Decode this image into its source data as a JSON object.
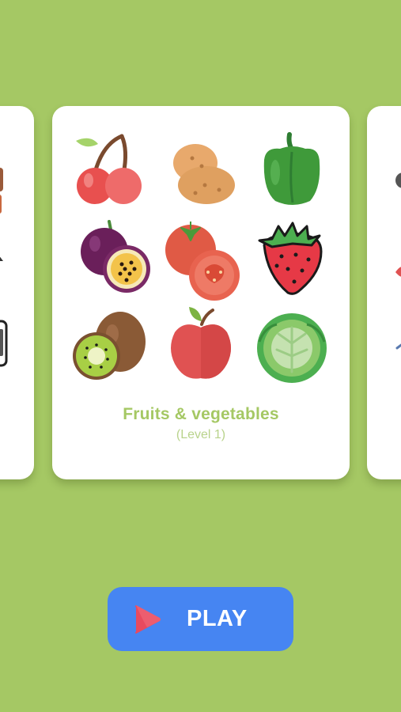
{
  "category": {
    "title": "Fruits & vegetables",
    "subtitle": "(Level 1)",
    "items": [
      {
        "icon": "cherry-icon"
      },
      {
        "icon": "potato-icon"
      },
      {
        "icon": "green-pepper-icon"
      },
      {
        "icon": "passion-fruit-icon"
      },
      {
        "icon": "tomato-icon"
      },
      {
        "icon": "strawberry-icon"
      },
      {
        "icon": "kiwi-icon"
      },
      {
        "icon": "apple-icon"
      },
      {
        "icon": "cabbage-icon"
      }
    ]
  },
  "play_button": {
    "label": "PLAY",
    "icon": "play-icon"
  },
  "colors": {
    "background": "#a5c864",
    "card": "#ffffff",
    "title": "#a5c864",
    "button": "#4685f2",
    "play_icon": "#e84a5f"
  }
}
